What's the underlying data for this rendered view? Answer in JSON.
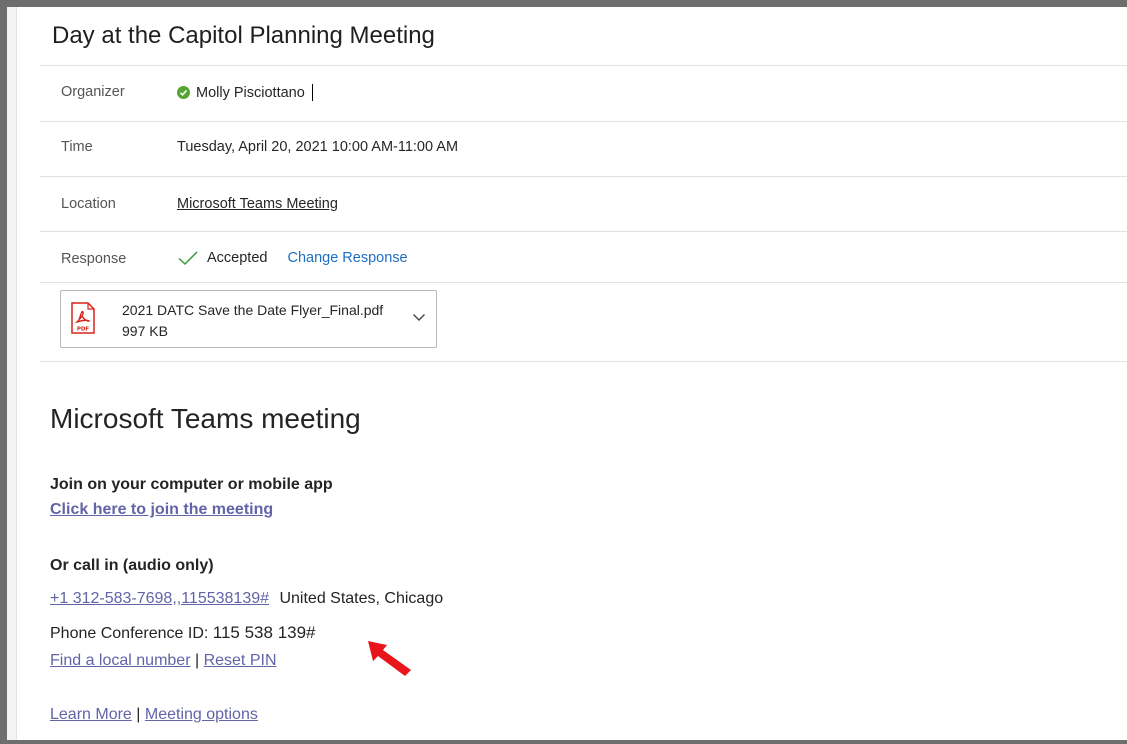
{
  "event": {
    "title": "Day at the Capitol Planning Meeting"
  },
  "details": {
    "organizer": {
      "label": "Organizer",
      "value": "Molly Pisciottano",
      "status_icon": "available-check-icon",
      "status_color": "#55a630"
    },
    "time": {
      "label": "Time",
      "value": "Tuesday, April 20, 2021 10:00 AM-11:00 AM"
    },
    "location": {
      "label": "Location",
      "value": "Microsoft Teams Meeting"
    },
    "response": {
      "label": "Response",
      "value": "Accepted",
      "change_link": "Change Response",
      "icon": "checkmark-icon",
      "icon_color": "#3a9a3a",
      "link_color": "#1e6fc4"
    }
  },
  "attachment": {
    "name": "2021 DATC Save the Date Flyer_Final.pdf",
    "size": "997 KB",
    "icon": "pdf-icon",
    "icon_text": "PDF",
    "icon_color": "#d9241c"
  },
  "teams": {
    "heading": "Microsoft Teams meeting",
    "join_heading": "Join on your computer or mobile app",
    "join_link": "Click here to join the meeting",
    "call_heading": "Or call in (audio only)",
    "phone_link": "+1 312-583-7698,,115538139#",
    "phone_region": "United States, Chicago",
    "conf_id_label": "Phone Conference ID:",
    "conf_id_value": "115 538 139#",
    "find_local": "Find a local number",
    "reset_pin": "Reset PIN",
    "learn_more": "Learn More",
    "meeting_options": "Meeting options",
    "separator": "|",
    "link_color": "#6264a7"
  },
  "annotation": {
    "icon": "red-arrow-icon",
    "color": "#e8161b"
  }
}
